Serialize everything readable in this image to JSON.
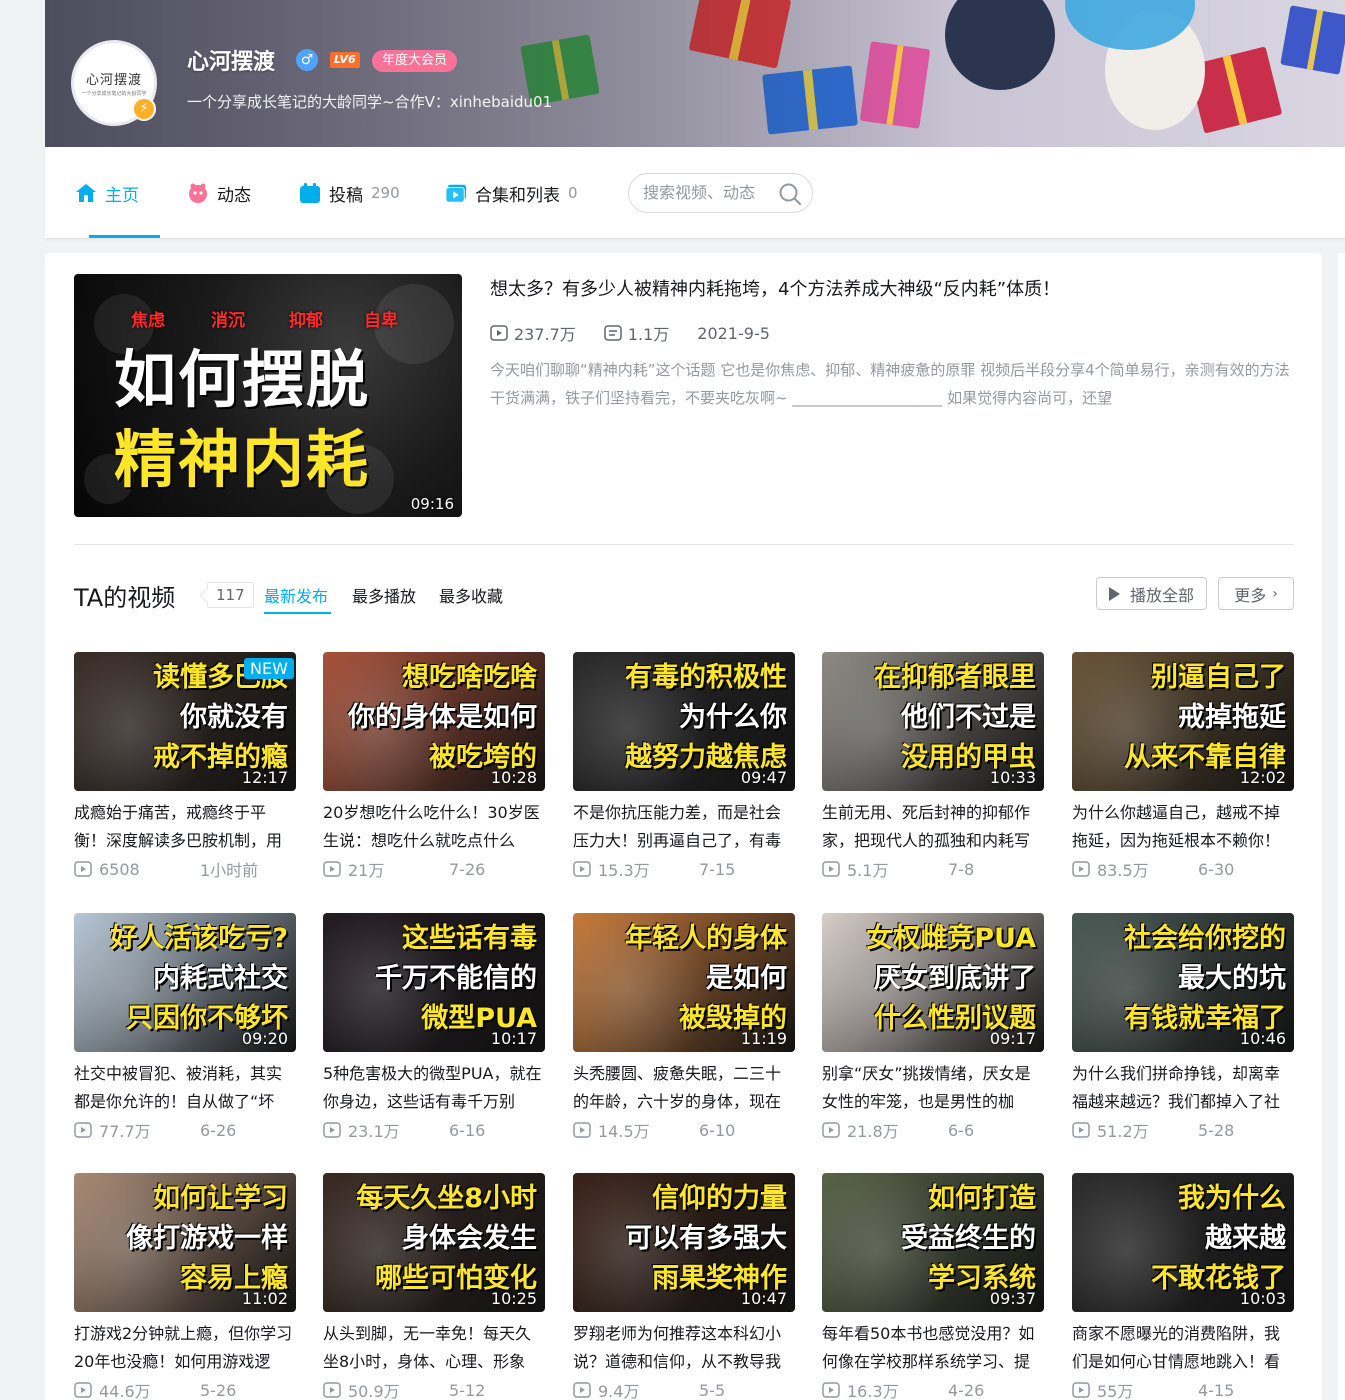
{
  "profile": {
    "avatar_logo": "心河摆渡",
    "avatar_sub": "一个分享成长笔记的大龄同学",
    "name": "心河摆渡",
    "gender_symbol": "♂",
    "level": "LV6",
    "vip": "年度大会员",
    "sign": "一个分享成长笔记的大龄同学~合作V：xinhebaidu01"
  },
  "nav": {
    "home": "主页",
    "dynamic": "动态",
    "uploads": "投稿",
    "uploads_count": "290",
    "collections": "合集和列表",
    "collections_count": "0",
    "search_placeholder": "搜索视频、动态"
  },
  "featured": {
    "tags": [
      "焦虑",
      "消沉",
      "抑郁",
      "自卑"
    ],
    "cover_line1": "如何摆脱",
    "cover_line2": "精神内耗",
    "duration": "09:16",
    "title": "想太多？有多少人被精神内耗拖垮，4个方法养成大神级“反内耗”体质！",
    "plays": "237.7万",
    "comments": "1.1万",
    "date": "2021-9-5",
    "desc": "今天咱们聊聊“精神内耗”这个话题 它也是你焦虑、抑郁、精神疲惫的原罪 视频后半段分享4个简单易行，亲测有效的方法 干货满满，铁子们坚持看完，不要夹吃灰啊~ ____________________ 如果觉得内容尚可，还望"
  },
  "section": {
    "title": "TA的视频",
    "count": "117",
    "tabs": [
      "最新发布",
      "最多播放",
      "最多收藏"
    ],
    "play_all": "播放全部",
    "more": "更多"
  },
  "new_badge": "NEW",
  "videos": [
    {
      "cap1": "读懂多巴胺",
      "cap2": "你就没有",
      "cap3": "戒不掉的瘾",
      "duration": "12:17",
      "title": "成瘾始于痛苦，戒瘾终于平衡！深度解读多巴胺机制，用",
      "plays": "6508",
      "date": "1小时前",
      "bg": "#3c2f29"
    },
    {
      "cap1": "想吃啥吃啥",
      "cap2": "你的身体是如何",
      "cap3": "被吃垮的",
      "duration": "10:28",
      "title": "20岁想吃什么吃什么！30岁医生说：想吃什么就吃点什么",
      "plays": "21万",
      "date": "7-26",
      "bg": "#a9523a"
    },
    {
      "cap1": "有毒的积极性",
      "cap2": "为什么你",
      "cap3": "越努力越焦虑",
      "duration": "09:47",
      "title": "不是你抗压能力差，而是社会压力大！别再逼自己了，有毒",
      "plays": "15.3万",
      "date": "7-15",
      "bg": "#2b2b2b"
    },
    {
      "cap1": "在抑郁者眼里",
      "cap2": "他们不过是",
      "cap3": "没用的甲虫",
      "duration": "10:33",
      "title": "生前无用、死后封神的抑郁作家，把现代人的孤独和内耗写",
      "plays": "5.1万",
      "date": "7-8",
      "bg": "#8e8a84"
    },
    {
      "cap1": "别逼自己了",
      "cap2": "戒掉拖延",
      "cap3": "从来不靠自律",
      "duration": "12:02",
      "title": "为什么你越逼自己，越戒不掉拖延，因为拖延根本不赖你！",
      "plays": "83.5万",
      "date": "6-30",
      "bg": "#6a5436"
    },
    {
      "cap1": "好人活该吃亏?",
      "cap2": "内耗式社交",
      "cap3": "只因你不够坏",
      "duration": "09:20",
      "title": "社交中被冒犯、被消耗，其实都是你允许的！自从做了“坏",
      "plays": "77.7万",
      "date": "6-26",
      "bg": "#b9c9d8"
    },
    {
      "cap1": "这些话有毒",
      "cap2": "千万不能信的",
      "cap3": "微型PUA",
      "duration": "10:17",
      "title": "5种危害极大的微型PUA，就在你身边，这些话有毒千万别",
      "plays": "23.1万",
      "date": "6-16",
      "bg": "#241c22"
    },
    {
      "cap1": "年轻人的身体",
      "cap2": "是如何",
      "cap3": "被毁掉的",
      "duration": "11:19",
      "title": "头秃腰圆、疲惫失眠，二三十的年龄，六十岁的身体，现在",
      "plays": "14.5万",
      "date": "6-10",
      "bg": "#c77a3b"
    },
    {
      "cap1": "女权雌竞PUA",
      "cap2": "厌女到底讲了",
      "cap3": "什么性别议题",
      "duration": "09:17",
      "title": "别拿“厌女”挑拨情绪，厌女是女性的牢笼，也是男性的枷",
      "plays": "21.8万",
      "date": "6-6",
      "bg": "#d9cfc9"
    },
    {
      "cap1": "社会给你挖的",
      "cap2": "最大的坑",
      "cap3": "有钱就幸福了",
      "duration": "10:46",
      "title": "为什么我们拼命挣钱，却离幸福越来越远？我们都掉入了社",
      "plays": "51.2万",
      "date": "5-28",
      "bg": "#4b5a55"
    },
    {
      "cap1": "如何让学习",
      "cap2": "像打游戏一样",
      "cap3": "容易上瘾",
      "duration": "11:02",
      "title": "打游戏2分钟就上瘾，但你学习20年也没瘾！如何用游戏逻",
      "plays": "44.6万",
      "date": "5-26",
      "bg": "#a98a74"
    },
    {
      "cap1": "每天久坐8小时",
      "cap2": "身体会发生",
      "cap3": "哪些可怕变化",
      "duration": "10:25",
      "title": "从头到脚，无一幸免！每天久坐8小时，身体、心理、形象",
      "plays": "50.9万",
      "date": "5-12",
      "bg": "#3a2a24"
    },
    {
      "cap1": "信仰的力量",
      "cap2": "可以有多强大",
      "cap3": "雨果奖神作",
      "duration": "10:47",
      "title": "罗翔老师为何推荐这本科幻小说？道德和信仰，从不教导我",
      "plays": "9.4万",
      "date": "5-5",
      "bg": "#3b2319"
    },
    {
      "cap1": "如何打造",
      "cap2": "受益终生的",
      "cap3": "学习系统",
      "duration": "09:37",
      "title": "每年看50本书也感觉没用？如何像在学校那样系统学习、提",
      "plays": "16.3万",
      "date": "4-26",
      "bg": "#586348"
    },
    {
      "cap1": "我为什么",
      "cap2": "越来越",
      "cap3": "不敢花钱了",
      "duration": "10:03",
      "title": "商家不愿曝光的消费陷阱，我们是如何心甘情愿地跳入！看",
      "plays": "55万",
      "date": "4-15",
      "bg": "#2c2c2c"
    }
  ]
}
